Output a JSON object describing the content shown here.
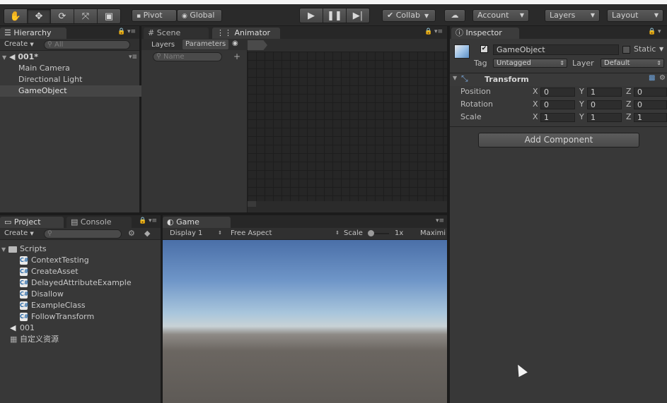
{
  "toolbar": {
    "pivot": "Pivot",
    "global": "Global",
    "collab": "Collab",
    "account": "Account",
    "layers": "Layers",
    "layout": "Layout"
  },
  "hierarchy": {
    "tab": "Hierarchy",
    "create": "Create",
    "search_placeholder": "All",
    "scene": "001*",
    "items": [
      "Main Camera",
      "Directional Light",
      "GameObject"
    ]
  },
  "scene_tab": "Scene",
  "animator": {
    "tab": "Animator",
    "layers_tab": "Layers",
    "parameters_tab": "Parameters",
    "search_placeholder": "Name",
    "add": "+"
  },
  "project": {
    "tab": "Project",
    "console_tab": "Console",
    "create": "Create",
    "folder": "Scripts",
    "scripts": [
      "ContextTesting",
      "CreateAsset",
      "DelayedAttributeExample",
      "Disallow",
      "ExampleClass",
      "FollowTransform"
    ],
    "scene_asset": "001",
    "custom_asset": "自定义资源"
  },
  "game": {
    "tab": "Game",
    "display": "Display 1",
    "aspect": "Free Aspect",
    "scale_label": "Scale",
    "scale_value": "1x",
    "maximize": "Maximi"
  },
  "inspector": {
    "tab": "Inspector",
    "name": "GameObject",
    "static_label": "Static",
    "tag_label": "Tag",
    "tag_value": "Untagged",
    "layer_label": "Layer",
    "layer_value": "Default",
    "transform_label": "Transform",
    "position_label": "Position",
    "rotation_label": "Rotation",
    "scale_label": "Scale",
    "axis_x": "X",
    "axis_y": "Y",
    "axis_z": "Z",
    "position": {
      "x": "0",
      "y": "1",
      "z": "0"
    },
    "rotation": {
      "x": "0",
      "y": "0",
      "z": "0"
    },
    "scale": {
      "x": "1",
      "y": "1",
      "z": "1"
    },
    "add_component": "Add Component"
  },
  "icons": [
    "hand-tool-icon",
    "move-tool-icon",
    "rotate-tool-icon",
    "scale-tool-icon",
    "rect-tool-icon",
    "play-icon",
    "pause-icon",
    "step-icon",
    "cloud-icon",
    "lock-icon",
    "menu-icon",
    "unity-scene-icon",
    "script-icon",
    "folder-icon",
    "cube-icon"
  ]
}
